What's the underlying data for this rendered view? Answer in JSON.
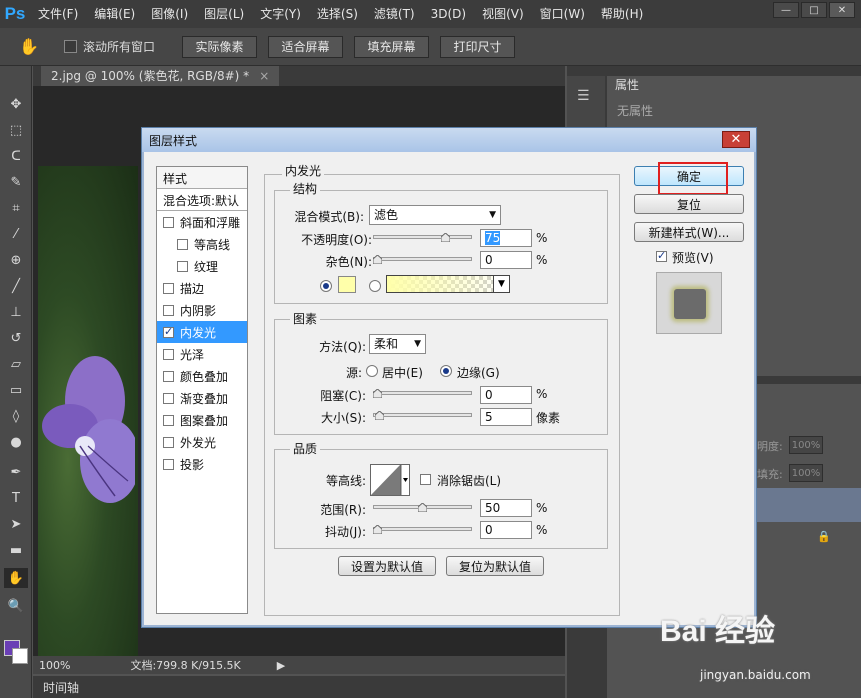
{
  "app": {
    "logo": "Ps"
  },
  "menu": [
    "文件(F)",
    "编辑(E)",
    "图像(I)",
    "图层(L)",
    "文字(Y)",
    "选择(S)",
    "滤镜(T)",
    "3D(D)",
    "视图(V)",
    "窗口(W)",
    "帮助(H)"
  ],
  "window_controls": {
    "minimize": "—",
    "maximize": "□",
    "close": "✕"
  },
  "options_bar": {
    "scroll_all_label": "滚动所有窗口",
    "buttons": [
      "实际像素",
      "适合屏幕",
      "填充屏幕",
      "打印尺寸"
    ]
  },
  "document": {
    "tab_title": "2.jpg @ 100% (紫色花, RGB/8#) *",
    "tab_close": "×",
    "zoom": "100%",
    "doc_info": "文档:799.8 K/915.5K",
    "timeline": "时间轴"
  },
  "properties_panel": {
    "tab": "属性",
    "empty_text": "无属性"
  },
  "layers_panel": {
    "opacity_label": "明度:",
    "opacity_value": "100%",
    "fill_label": "填充:",
    "fill_value": "100%"
  },
  "dialog": {
    "title": "图层样式",
    "close": "✕",
    "style_list": {
      "header": "样式",
      "blend_options": "混合选项:默认",
      "items": [
        {
          "label": "斜面和浮雕",
          "checked": false,
          "sub": false,
          "active": false
        },
        {
          "label": "等高线",
          "checked": false,
          "sub": true,
          "active": false
        },
        {
          "label": "纹理",
          "checked": false,
          "sub": true,
          "active": false
        },
        {
          "label": "描边",
          "checked": false,
          "sub": false,
          "active": false
        },
        {
          "label": "内阴影",
          "checked": false,
          "sub": false,
          "active": false
        },
        {
          "label": "内发光",
          "checked": true,
          "sub": false,
          "active": true
        },
        {
          "label": "光泽",
          "checked": false,
          "sub": false,
          "active": false
        },
        {
          "label": "颜色叠加",
          "checked": false,
          "sub": false,
          "active": false
        },
        {
          "label": "渐变叠加",
          "checked": false,
          "sub": false,
          "active": false
        },
        {
          "label": "图案叠加",
          "checked": false,
          "sub": false,
          "active": false
        },
        {
          "label": "外发光",
          "checked": false,
          "sub": false,
          "active": false
        },
        {
          "label": "投影",
          "checked": false,
          "sub": false,
          "active": false
        }
      ]
    },
    "inner_glow": {
      "group_title": "内发光",
      "structure": {
        "title": "结构",
        "blend_mode_label": "混合模式(B):",
        "blend_mode_value": "滤色",
        "opacity_label": "不透明度(O):",
        "opacity_value": "75",
        "opacity_fraction": 0.75,
        "noise_label": "杂色(N):",
        "noise_value": "0",
        "noise_fraction": 0,
        "unit_percent": "%",
        "glow_color": "#ffffaa"
      },
      "elements": {
        "title": "图素",
        "method_label": "方法(Q):",
        "method_value": "柔和",
        "source_label": "源:",
        "source_center": "居中(E)",
        "source_edge": "边缘(G)",
        "choke_label": "阻塞(C):",
        "choke_value": "0",
        "choke_fraction": 0,
        "size_label": "大小(S):",
        "size_value": "5",
        "size_fraction": 0.02,
        "size_unit": "像素"
      },
      "quality": {
        "title": "品质",
        "contour_label": "等高线:",
        "anti_alias_label": "消除锯齿(L)",
        "range_label": "范围(R):",
        "range_value": "50",
        "range_fraction": 0.5,
        "jitter_label": "抖动(J):",
        "jitter_value": "0",
        "jitter_fraction": 0
      },
      "set_default": "设置为默认值",
      "reset_default": "复位为默认值"
    },
    "buttons": {
      "ok": "确定",
      "reset": "复位",
      "new_style": "新建样式(W)...",
      "preview_label": "预览(V)"
    }
  },
  "watermark": {
    "main": "Bai 经验",
    "sub": "jingyan.baidu.com"
  }
}
